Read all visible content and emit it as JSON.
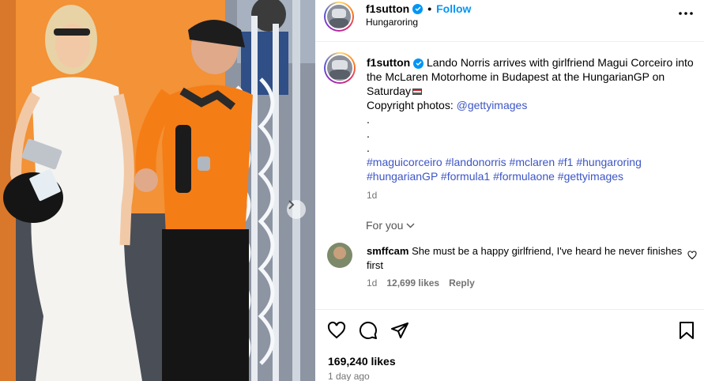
{
  "post": {
    "username": "f1sutton",
    "follow_label": "Follow",
    "location": "Hungaroring",
    "caption_text": "Lando Norris arrives with girlfriend Magui Corceiro into the McLaren Motorhome in Budapest at the HungarianGP on Saturday",
    "copyright_label": "Copyright photos:",
    "copyright_handle": "@gettyimages",
    "dots": ".",
    "hashtags_line1": "#maguicorceiro #landonorris #mclaren #f1 #hungaroring",
    "hashtags_line2": "#hungarianGP #formula1 #formulaone #gettyimages",
    "caption_age": "1d",
    "likes": "169,240 likes",
    "posted_ago": "1 day ago"
  },
  "for_you_label": "For you",
  "comment": {
    "username": "smffcam",
    "text": "She must be a happy girlfriend, I've heard he never finishes first",
    "age": "1d",
    "likes": "12,699 likes",
    "reply_label": "Reply"
  },
  "icons": [
    "verified-icon",
    "more-options-icon",
    "chevron-down-icon",
    "heart-icon",
    "comment-icon",
    "share-icon",
    "bookmark-icon",
    "next-arrow-icon",
    "flag-icon"
  ]
}
